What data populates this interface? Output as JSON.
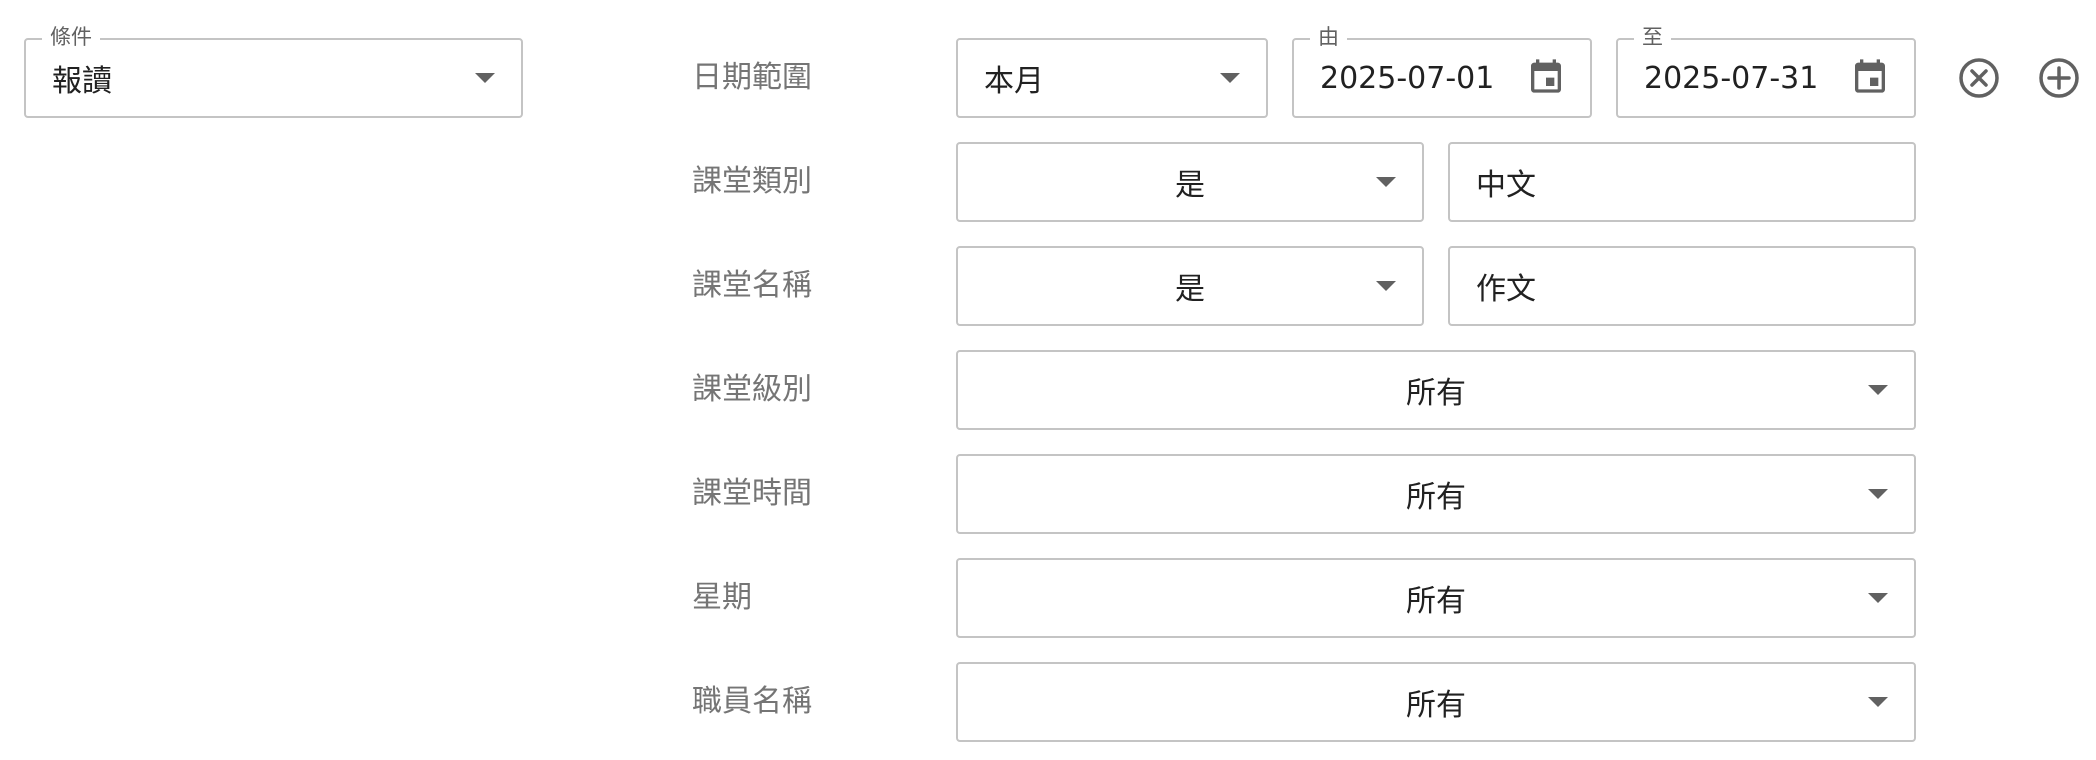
{
  "condition": {
    "legend": "條件",
    "value": "報讀"
  },
  "date_range": {
    "label": "日期範圍",
    "period": "本月",
    "from_legend": "由",
    "from_value": "2025-07-01",
    "to_legend": "至",
    "to_value": "2025-07-31"
  },
  "class_category": {
    "label": "課堂類別",
    "operator": "是",
    "value": "中文"
  },
  "class_name": {
    "label": "課堂名稱",
    "operator": "是",
    "value": "作文"
  },
  "class_level": {
    "label": "課堂級別",
    "value": "所有"
  },
  "class_time": {
    "label": "課堂時間",
    "value": "所有"
  },
  "weekday": {
    "label": "星期",
    "value": "所有"
  },
  "staff_name": {
    "label": "職員名稱",
    "value": "所有"
  },
  "icons": {
    "dropdown": "caret-down-icon",
    "calendar": "calendar-icon",
    "remove": "remove-circle-icon",
    "add": "add-circle-icon"
  },
  "colors": {
    "border": "#c4c4c4",
    "label_text": "#757575",
    "icon": "#616161"
  }
}
